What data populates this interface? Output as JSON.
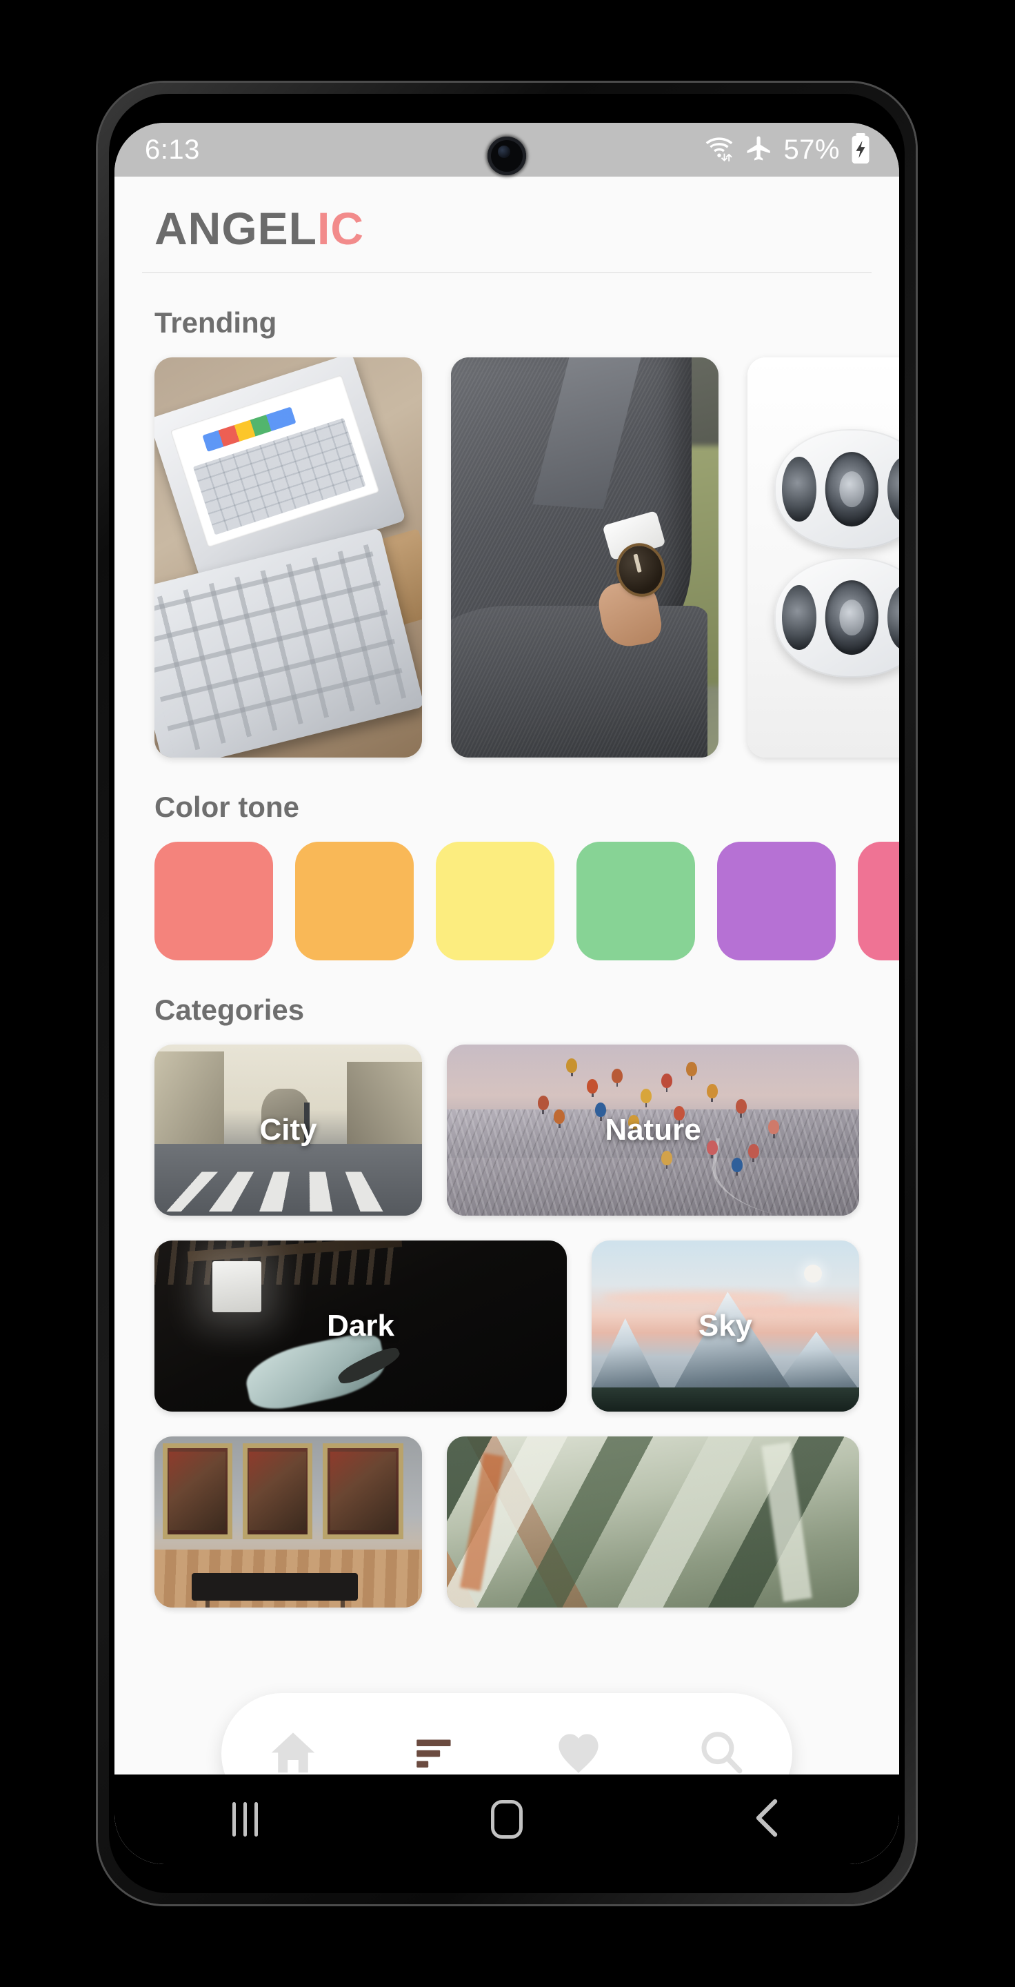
{
  "status_bar": {
    "time": "6:13",
    "battery_percent": "57%",
    "icons": [
      "wifi-data-icon",
      "airplane-mode-icon",
      "battery-charging-icon"
    ]
  },
  "header": {
    "title_part1": "ANGEL",
    "title_part2": "IC",
    "title_color1": "#6b6b6b",
    "title_color2": "#f28b8b"
  },
  "sections": {
    "trending": {
      "title": "Trending",
      "cards": [
        {
          "name": "tablet-keyboard-desk"
        },
        {
          "name": "man-grey-suit-watch"
        },
        {
          "name": "white-fidget-spinners"
        }
      ]
    },
    "color_tone": {
      "title": "Color tone",
      "swatches": [
        {
          "name": "coral",
          "hex": "#f4837c"
        },
        {
          "name": "orange",
          "hex": "#f9b857"
        },
        {
          "name": "yellow",
          "hex": "#fced7f"
        },
        {
          "name": "green",
          "hex": "#87d395"
        },
        {
          "name": "purple",
          "hex": "#b濃"
        },
        {
          "name": "pink",
          "hex": "#ef7394"
        }
      ]
    },
    "categories": {
      "title": "Categories",
      "rows": [
        [
          {
            "label": "City",
            "art": "city-street",
            "size": "small"
          },
          {
            "label": "Nature",
            "art": "hot-air-balloons",
            "size": "large"
          }
        ],
        [
          {
            "label": "Dark",
            "art": "dark-attic",
            "size": "large"
          },
          {
            "label": "Sky",
            "art": "snow-mountains-dusk",
            "size": "small"
          }
        ],
        [
          {
            "label": "",
            "art": "museum-gallery",
            "size": "small"
          },
          {
            "label": "",
            "art": "abstract-paint",
            "size": "large"
          }
        ]
      ]
    }
  },
  "bottom_nav": {
    "items": [
      {
        "name": "home-icon",
        "label": "Home",
        "active": false
      },
      {
        "name": "filter-icon",
        "label": "Collections",
        "active": true
      },
      {
        "name": "heart-icon",
        "label": "Favorites",
        "active": false
      },
      {
        "name": "search-icon",
        "label": "Search",
        "active": false
      }
    ],
    "active_color": "#6b4b40",
    "inactive_color": "#e0e0e0"
  },
  "android_nav": {
    "items": [
      {
        "name": "recents-icon",
        "label": "Recents"
      },
      {
        "name": "home-icon",
        "label": "Home"
      },
      {
        "name": "back-icon",
        "label": "Back"
      }
    ]
  }
}
